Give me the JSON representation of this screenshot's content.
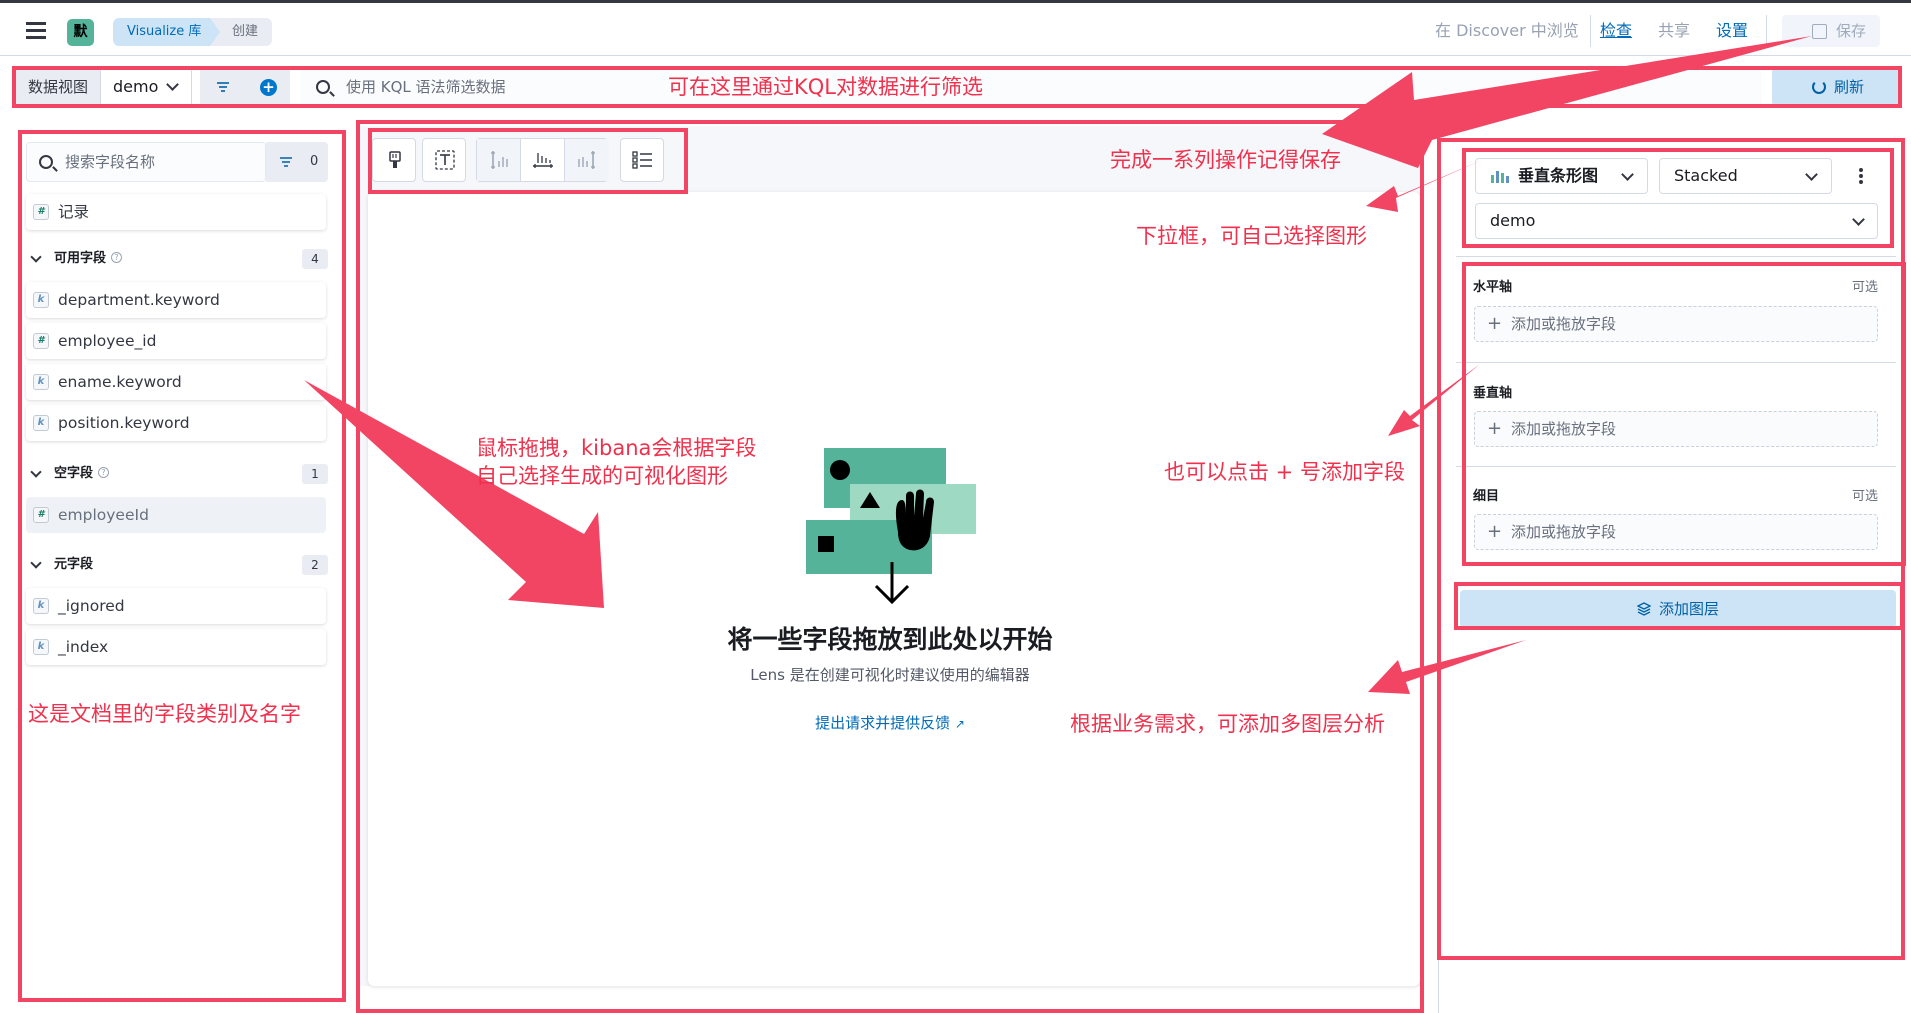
{
  "header": {
    "space_initial": "默",
    "breadcrumbs": [
      "Visualize 库",
      "创建"
    ],
    "discover_link": "在 Discover 中浏览",
    "inspect": "检查",
    "share": "共享",
    "settings": "设置",
    "save": "保存"
  },
  "query_bar": {
    "data_view_label": "数据视图",
    "data_view_value": "demo",
    "kql_placeholder": "使用 KQL 语法筛选数据",
    "refresh": "刷新"
  },
  "field_list": {
    "search_placeholder": "搜索字段名称",
    "filter_count": "0",
    "records_item": "记录",
    "sections": [
      {
        "title": "可用字段",
        "count": "4",
        "fields": [
          {
            "type": "k",
            "name": "department.keyword"
          },
          {
            "type": "#",
            "name": "employee_id"
          },
          {
            "type": "k",
            "name": "ename.keyword"
          },
          {
            "type": "k",
            "name": "position.keyword"
          }
        ]
      },
      {
        "title": "空字段",
        "count": "1",
        "fields": [
          {
            "type": "#",
            "name": "employeeId"
          }
        ]
      },
      {
        "title": "元字段",
        "count": "2",
        "fields": [
          {
            "type": "k",
            "name": "_ignored"
          },
          {
            "type": "k",
            "name": "_index"
          }
        ]
      }
    ]
  },
  "workspace": {
    "empty_title": "将一些字段拖放到此处以开始",
    "empty_subtitle": "Lens 是在创建可视化时建议使用的编辑器",
    "feedback_link": "提出请求并提供反馈"
  },
  "config_panel": {
    "chart_type": "垂直条形图",
    "stack_mode": "Stacked",
    "layer_data_view": "demo",
    "horizontal_axis": "水平轴",
    "vertical_axis": "垂直轴",
    "breakdown": "细目",
    "optional": "可选",
    "drop_field": "添加或拖放字段",
    "add_layer": "添加图层"
  },
  "annotations": {
    "kql": "可在这里通过KQL对数据进行筛选",
    "save_reminder": "完成一系列操作记得保存",
    "dropdown": "下拉框，可自己选择图形",
    "drag_line1": "鼠标拖拽，kibana会根据字段",
    "drag_line2": "自己选择生成的可视化图形",
    "plus_add": "也可以点击 + 号添加字段",
    "fields_desc": "这是文档里的字段类别及名字",
    "multi_layer": "根据业务需求，可添加多图层分析"
  },
  "colors": {
    "annotation": "#f24463",
    "accent": "#0077cc",
    "illustration": "#54b399"
  }
}
